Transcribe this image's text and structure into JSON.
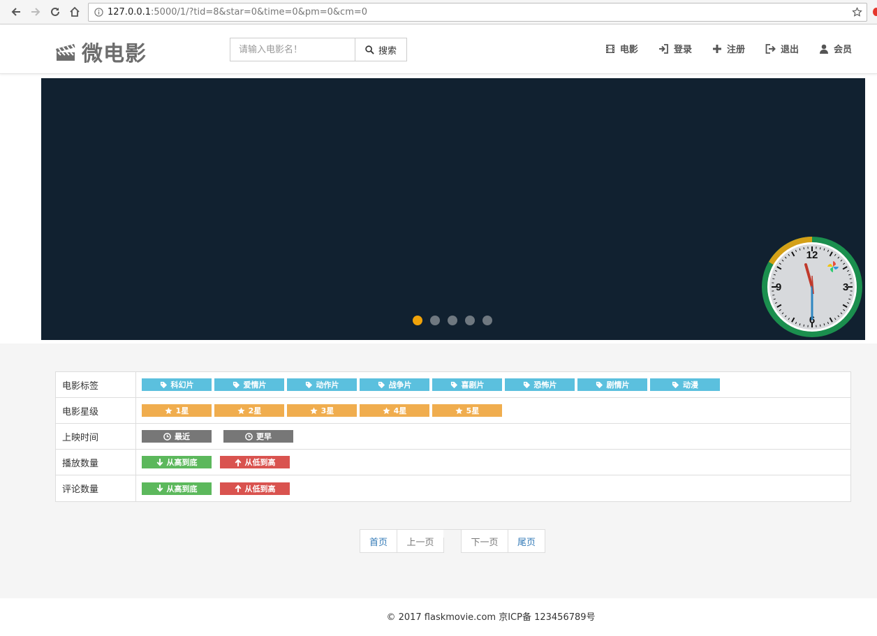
{
  "browser": {
    "url_host": "127.0.0.1",
    "url_rest": ":5000/1/?tid=8&star=0&time=0&pm=0&cm=0"
  },
  "header": {
    "brand": "微电影",
    "search_placeholder": "请输入电影名！",
    "search_button": "搜索",
    "nav": [
      {
        "label": "电影",
        "icon": "film-icon"
      },
      {
        "label": "登录",
        "icon": "login-icon"
      },
      {
        "label": "注册",
        "icon": "plus-icon"
      },
      {
        "label": "退出",
        "icon": "logout-icon"
      },
      {
        "label": "会员",
        "icon": "user-icon"
      }
    ]
  },
  "carousel": {
    "slide_count": 5,
    "active_index": 0,
    "clock": {
      "numerals": [
        "12",
        "3",
        "6",
        "9"
      ]
    }
  },
  "filters": {
    "tags_label": "电影标签",
    "tags": [
      "科幻片",
      "爱情片",
      "动作片",
      "战争片",
      "喜剧片",
      "恐怖片",
      "剧情片",
      "动漫"
    ],
    "stars_label": "电影星级",
    "stars": [
      "1星",
      "2星",
      "3星",
      "4星",
      "5星"
    ],
    "time_label": "上映时间",
    "time": [
      "最近",
      "更早"
    ],
    "play_label": "播放数量",
    "play": [
      "从高到底",
      "从低到高"
    ],
    "comment_label": "评论数量",
    "comment": [
      "从高到底",
      "从低到高"
    ]
  },
  "pagination": {
    "first": "首页",
    "prev": "上一页",
    "next": "下一页",
    "last": "尾页"
  },
  "footer": {
    "text": "© 2017 flaskmovie.com 京ICP备 123456789号"
  },
  "colors": {
    "info": "#5bc0de",
    "warning": "#f0ad4e",
    "default": "#777777",
    "success": "#5cb85c",
    "danger": "#d9534f",
    "carousel_bg": "#112130",
    "active_dot": "#f0a30a"
  }
}
